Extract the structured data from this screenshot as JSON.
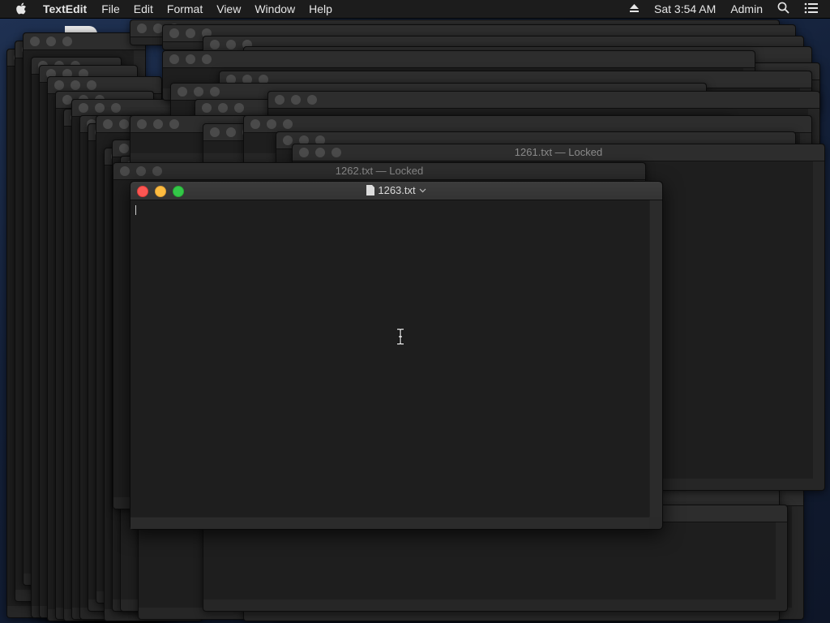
{
  "menubar": {
    "app_name": "TextEdit",
    "menus": [
      "File",
      "Edit",
      "Format",
      "View",
      "Window",
      "Help"
    ],
    "clock": "Sat 3:54 AM",
    "user": "Admin",
    "icons": [
      "apple-icon",
      "eject-icon",
      "spotlight-search-icon",
      "notification-center-icon"
    ]
  },
  "windows": {
    "background_titles": {
      "w1261": "1261.txt — Locked",
      "w1262": "1262.txt — Locked"
    },
    "front": {
      "title": "1263.txt",
      "content": ""
    }
  },
  "colors": {
    "close": "#fc5753",
    "minimize": "#fdbc40",
    "zoom": "#33c748"
  }
}
